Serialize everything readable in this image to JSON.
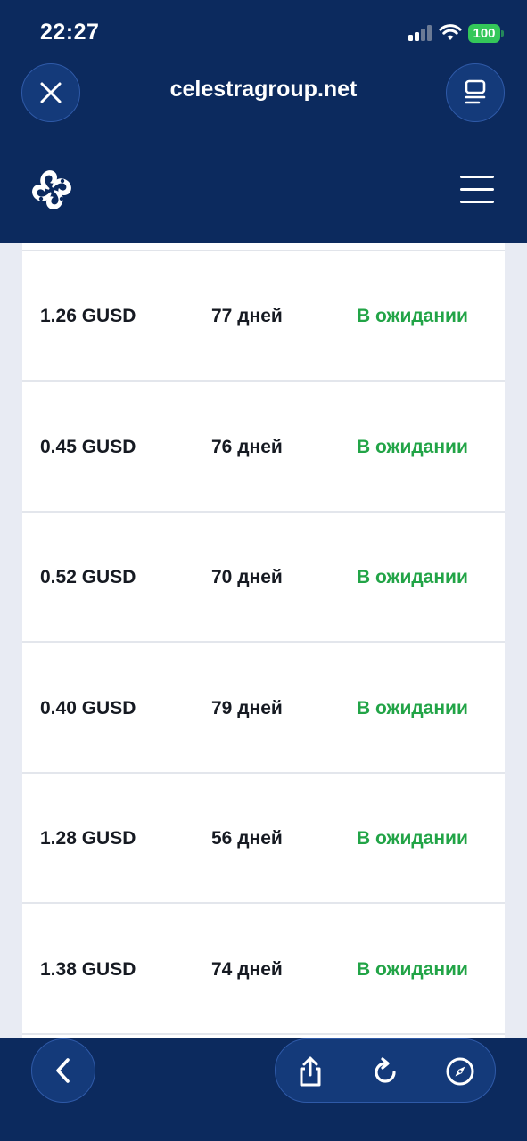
{
  "status_bar": {
    "time": "22:27",
    "battery": "100"
  },
  "browser": {
    "url": "celestragroup.net"
  },
  "rows": [
    {
      "amount": "1.26 GUSD",
      "days": "77 дней",
      "status": "В ожидании"
    },
    {
      "amount": "0.45 GUSD",
      "days": "76 дней",
      "status": "В ожидании"
    },
    {
      "amount": "0.52 GUSD",
      "days": "70 дней",
      "status": "В ожидании"
    },
    {
      "amount": "0.40 GUSD",
      "days": "79 дней",
      "status": "В ожидании"
    },
    {
      "amount": "1.28 GUSD",
      "days": "56 дней",
      "status": "В ожидании"
    },
    {
      "amount": "1.38 GUSD",
      "days": "74 дней",
      "status": "В ожидании"
    }
  ],
  "colors": {
    "header_bg": "#0c2a5e",
    "status_green": "#22a447",
    "battery_green": "#34c759"
  }
}
